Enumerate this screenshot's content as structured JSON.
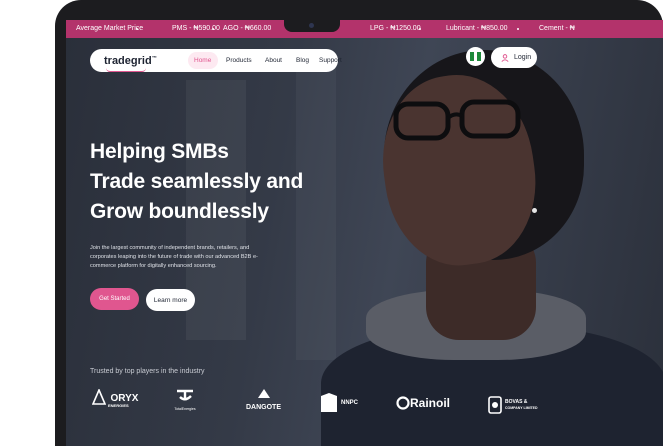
{
  "ticker": {
    "items": [
      "Average Market Price",
      "PMS - ₦590.00",
      "AGO - ₦660.00",
      "LPG - ₦1250.00",
      "Lubricant - ₦850.00",
      "Cement - ₦"
    ]
  },
  "nav": {
    "logo": "tradegrid",
    "logo_tm": "™",
    "items": [
      "Home",
      "Products",
      "About",
      "Blog",
      "Support"
    ],
    "active": "Home",
    "login_label": "Login"
  },
  "hero": {
    "headline_lines": [
      "Helping SMBs",
      "Trade seamlessly and",
      "Grow boundlessly"
    ],
    "subtext": "Join the largest community of independent brands, retailers, and corporates leaping into the future of trade with our advanced B2B e-commerce platform for digitally enhanced sourcing.",
    "primary_button": "Get Started",
    "secondary_button": "Learn more"
  },
  "partners": {
    "heading": "Trusted by top players in the industry",
    "logos": {
      "oryx_name": "ORYX",
      "oryx_sub": "ENERGIES",
      "total_name": "TotalEnergies",
      "dangote": "DANGOTE",
      "nnpc": "NNPC",
      "rainoil": "Rainoil",
      "bovas_name": "BOVAS &",
      "bovas_sub": "COMPANY LIMITED"
    }
  },
  "colors": {
    "accent": "#e0568f",
    "ticker_bg": "#b3336b",
    "dark": "#1d2331"
  },
  "icons": [
    "nigeria-flag-icon",
    "user-icon",
    "camera-icon"
  ]
}
